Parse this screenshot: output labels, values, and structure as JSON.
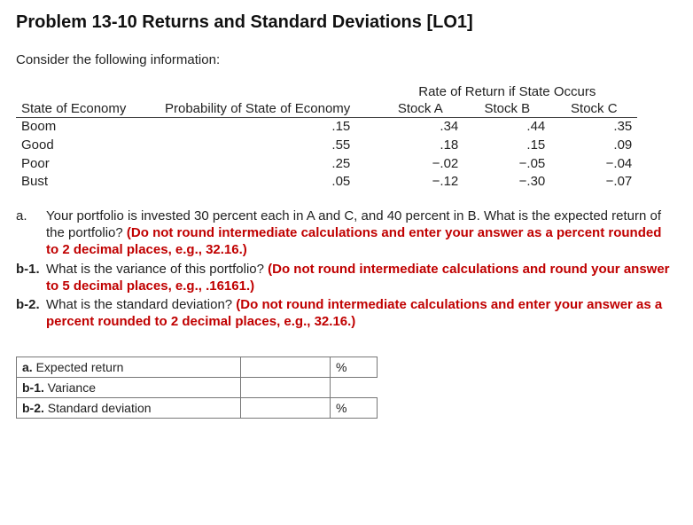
{
  "title": "Problem 13-10 Returns and Standard Deviations [LO1]",
  "intro": "Consider the following information:",
  "rate_header": "Rate of Return if State Occurs",
  "headers": {
    "state": "State of Economy",
    "prob": "Probability of State of Economy",
    "a": "Stock A",
    "b": "Stock B",
    "c": "Stock C"
  },
  "rows": [
    {
      "state": "Boom",
      "prob": ".15",
      "a": ".34",
      "b": ".44",
      "c": ".35"
    },
    {
      "state": "Good",
      "prob": ".55",
      "a": ".18",
      "b": ".15",
      "c": ".09"
    },
    {
      "state": "Poor",
      "prob": ".25",
      "a": "−.02",
      "b": "−.05",
      "c": "−.04"
    },
    {
      "state": "Bust",
      "prob": ".05",
      "a": "−.12",
      "b": "−.30",
      "c": "−.07"
    }
  ],
  "parts": {
    "a_label": "a.",
    "a_text": "Your portfolio is invested 30 percent each in A and C, and 40 percent in B. What is the expected return of the portfolio? ",
    "a_instr": "(Do not round intermediate calculations and enter your answer as a percent rounded to 2 decimal places, e.g., 32.16.)",
    "b1_label": "b-1.",
    "b1_text": "What is the variance of this portfolio? ",
    "b1_instr": "(Do not round intermediate calculations and round your answer to 5 decimal places, e.g., .16161.)",
    "b2_label": "b-2.",
    "b2_text": "What is the standard deviation? ",
    "b2_instr": "(Do not round intermediate calculations and enter your answer as a percent rounded to 2 decimal places, e.g., 32.16.)"
  },
  "answers": {
    "a_lab": "a. Expected return",
    "a_unit": "%",
    "b1_lab": "b-1. Variance",
    "b2_lab": "b-2. Standard deviation",
    "b2_unit": "%"
  },
  "chart_data": {
    "type": "table",
    "title": "Rate of Return if State Occurs",
    "columns": [
      "State of Economy",
      "Probability of State of Economy",
      "Stock A",
      "Stock B",
      "Stock C"
    ],
    "rows": [
      [
        "Boom",
        0.15,
        0.34,
        0.44,
        0.35
      ],
      [
        "Good",
        0.55,
        0.18,
        0.15,
        0.09
      ],
      [
        "Poor",
        0.25,
        -0.02,
        -0.05,
        -0.04
      ],
      [
        "Bust",
        0.05,
        -0.12,
        -0.3,
        -0.07
      ]
    ]
  }
}
